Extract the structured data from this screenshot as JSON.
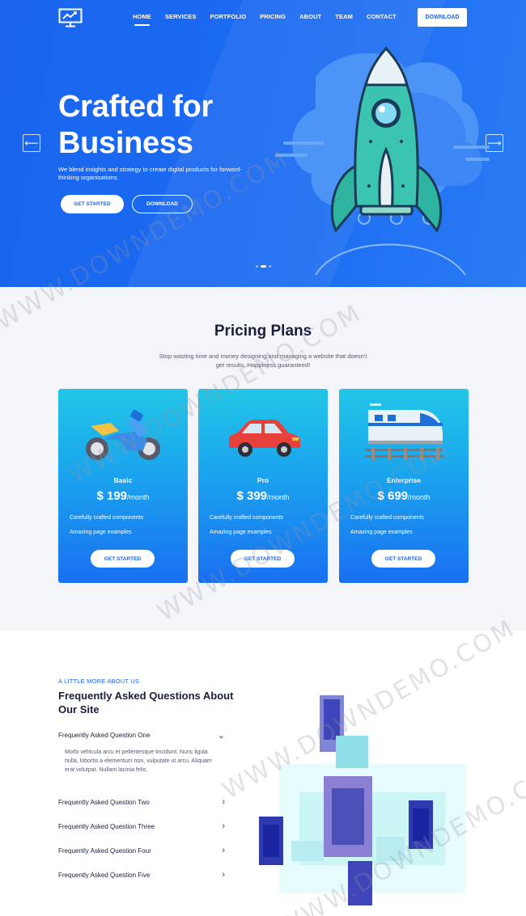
{
  "nav": {
    "items": [
      {
        "label": "HOME",
        "active": true
      },
      {
        "label": "SERVICES",
        "active": false
      },
      {
        "label": "PORTFOLIO",
        "active": false
      },
      {
        "label": "PRICING",
        "active": false
      },
      {
        "label": "ABOUT",
        "active": false
      },
      {
        "label": "TEAM",
        "active": false
      },
      {
        "label": "CONTACT",
        "active": false
      }
    ],
    "download_label": "DOWNLOAD"
  },
  "hero": {
    "title_line1": "Crafted for",
    "title_line2": "Business",
    "text": "We blend insights and strategy to create digital products for forward-thinking organisations.",
    "get_started_label": "GET STARTED",
    "download_label": "DOWNLOAD",
    "prev_icon": "arrow-left-icon",
    "next_icon": "arrow-right-icon",
    "slide_count": 3,
    "active_slide": 2
  },
  "pricing": {
    "title": "Pricing Plans",
    "subtitle": "Stop wasting time and money designing and managing a website that doesn't get results. Happiness guaranteed!",
    "plans": [
      {
        "name": "Basic",
        "price": "$ 199",
        "period": "/month",
        "feature1": "Carefully crafted components",
        "feature2": "Amazing page examples",
        "button": "GET STARTED",
        "icon": "motorcycle-icon"
      },
      {
        "name": "Pro",
        "price": "$ 399",
        "period": "/month",
        "feature1": "Carefully crafted components",
        "feature2": "Amazing page examples",
        "button": "GET STARTED",
        "icon": "car-icon"
      },
      {
        "name": "Enterprise",
        "price": "$ 699",
        "period": "/month",
        "feature1": "Carefully crafted components",
        "feature2": "Amazing page examples",
        "button": "GET STARTED",
        "icon": "train-icon"
      }
    ]
  },
  "faq": {
    "eyebrow": "A LITTLE MORE ABOUT US",
    "title": "Frequently Asked Questions About Our Site",
    "questions": [
      {
        "q": "Frequently Asked Question One",
        "open": true
      },
      {
        "q": "Frequently Asked Question Two",
        "open": false
      },
      {
        "q": "Frequently Asked Question Three",
        "open": false
      },
      {
        "q": "Frequently Asked Question Four",
        "open": false
      },
      {
        "q": "Frequently Asked Question Five",
        "open": false
      }
    ],
    "answer": "Morbi vehicula arcu et pellentesque tincidunt. Nunc ligula nulla, lobortis a elementum non, vulputate ut arcu. Aliquam erat volutpat. Nullam lacinia felis."
  },
  "watermark": "WWW.DOWNDEMO.COM",
  "colors": {
    "primary": "#1a64ee",
    "card_top": "#22c6e6",
    "card_bottom": "#1a6ff0",
    "pricing_bg": "#f3f5f9"
  }
}
